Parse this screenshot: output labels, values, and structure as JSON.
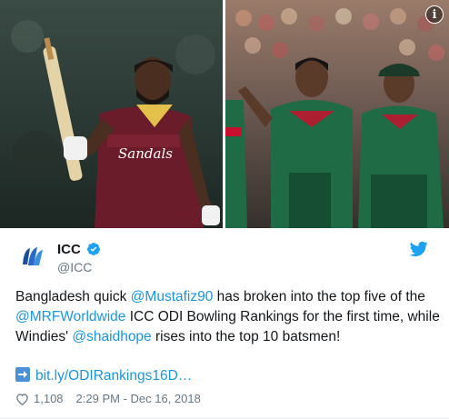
{
  "media": {
    "left_photo_alt_icon": "cricket-batsman-photo",
    "left_photo_shirt_text": "Sandals",
    "right_photo_alt_icon": "bangladesh-players-photo",
    "info_label": "i"
  },
  "tweet": {
    "author_name": "ICC",
    "author_handle": "@ICC",
    "text_parts": {
      "p1": "Bangladesh quick ",
      "mention1": "@Mustafiz90",
      "p2": " has broken into the top five of the ",
      "mention2": "@MRFWorldwide",
      "p3": " ICC ODI Bowling Rankings for the first time, while Windies' ",
      "mention3": "@shaidhope",
      "p4": " rises into the top 10 batsmen!"
    },
    "link_text": "bit.ly/ODIRankings16D…",
    "like_count": "1,108",
    "timestamp": "2:29 PM - Dec 16, 2018"
  },
  "colors": {
    "link": "#1b95e0",
    "muted": "#657786",
    "verified": "#1da1f2"
  }
}
